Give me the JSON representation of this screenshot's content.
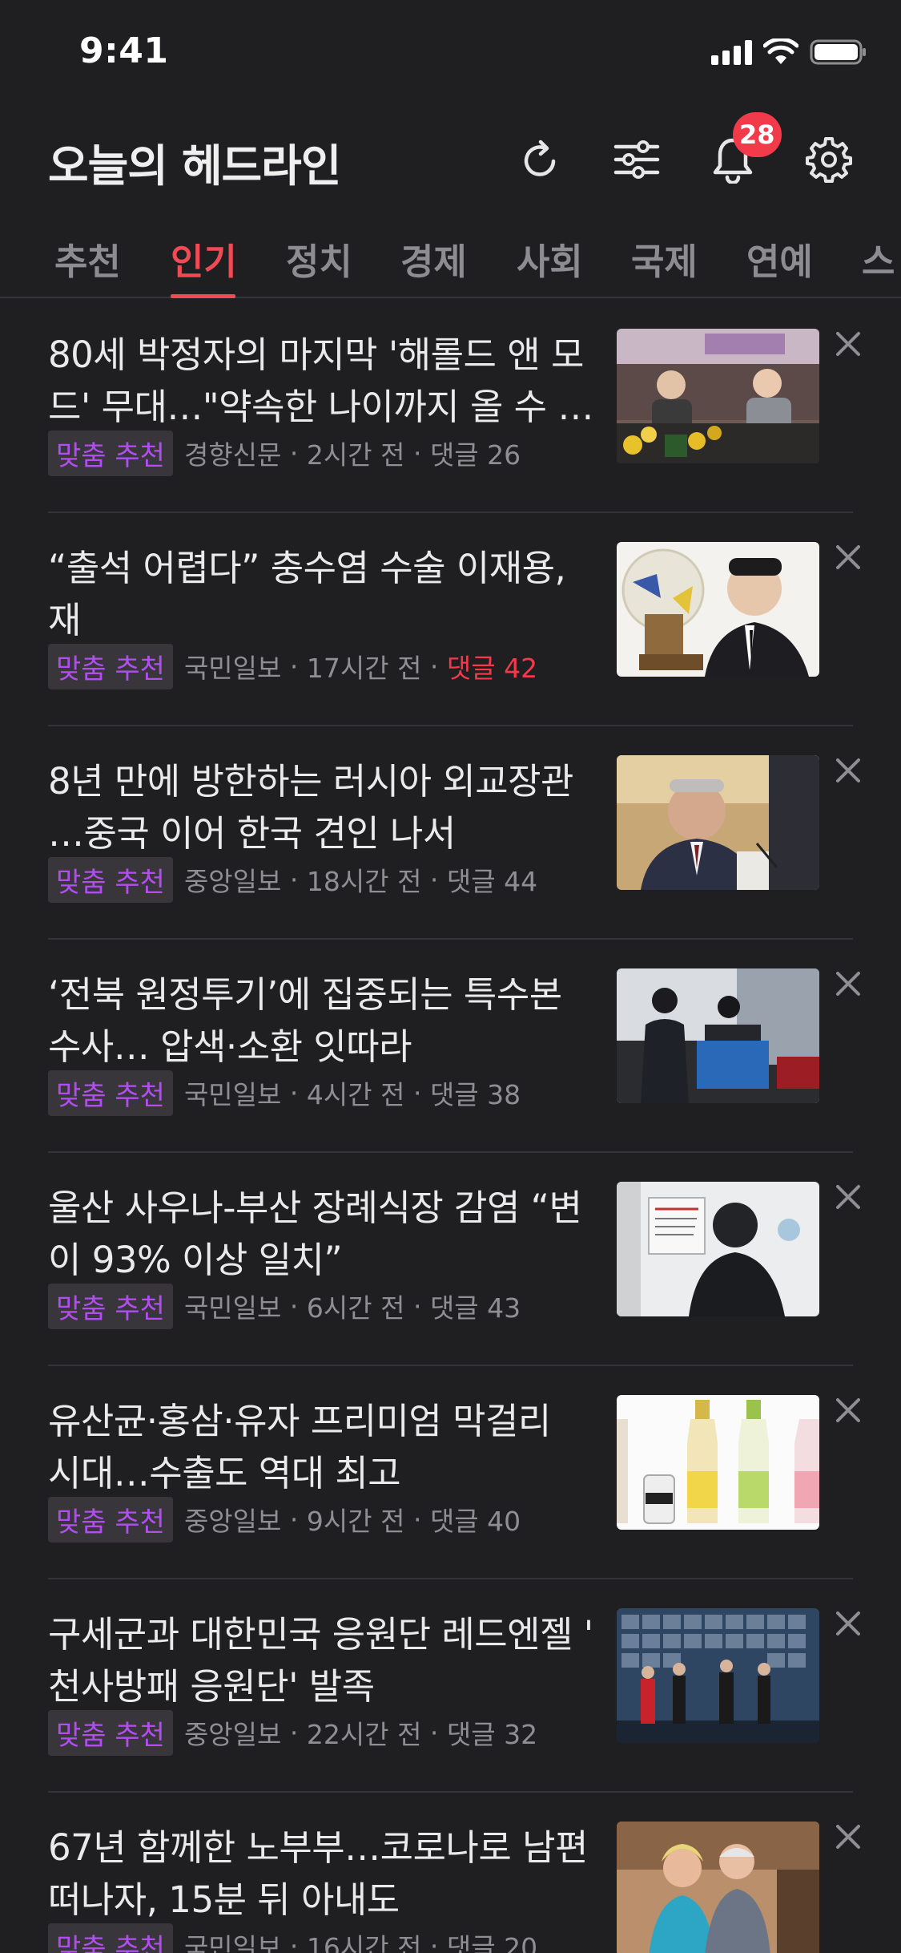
{
  "status_bar": {
    "time": "9:41"
  },
  "header": {
    "title": "오늘의 헤드라인",
    "notification_count": "28"
  },
  "tabs": [
    {
      "label": "추천",
      "active": false
    },
    {
      "label": "인기",
      "active": true
    },
    {
      "label": "정치",
      "active": false
    },
    {
      "label": "경제",
      "active": false
    },
    {
      "label": "사회",
      "active": false
    },
    {
      "label": "국제",
      "active": false
    },
    {
      "label": "연예",
      "active": false
    },
    {
      "label": "스",
      "active": false
    }
  ],
  "recommend_label": "맞춤 추천",
  "articles": [
    {
      "headline": "80세 박정자의 마지막 '해롤드 앤 모\n드' 무대…\"약속한 나이까지 올 수 …",
      "source": "경향신문",
      "time": "2시간 전",
      "comments": "댓글 26",
      "comments_hot": false
    },
    {
      "headline": "“출석 어렵다” 충수염 수술 이재용, 재\n판 연기 신청",
      "source": "국민일보",
      "time": "17시간 전",
      "comments": "댓글 42",
      "comments_hot": true
    },
    {
      "headline": "8년 만에 방한하는 러시아 외교장관\n…중국 이어 한국 견인 나서",
      "source": "중앙일보",
      "time": "18시간 전",
      "comments": "댓글 44",
      "comments_hot": false
    },
    {
      "headline": "‘전북 원정투기’에 집중되는 특수본\n수사… 압색·소환 잇따라",
      "source": "국민일보",
      "time": "4시간 전",
      "comments": "댓글 38",
      "comments_hot": false
    },
    {
      "headline": "울산 사우나-부산 장례식장 감염 “변\n이 93% 이상 일치”",
      "source": "국민일보",
      "time": "6시간 전",
      "comments": "댓글 43",
      "comments_hot": false
    },
    {
      "headline": "유산균·홍삼·유자 프리미엄 막걸리\n시대…수출도 역대 최고",
      "source": "중앙일보",
      "time": "9시간 전",
      "comments": "댓글 40",
      "comments_hot": false
    },
    {
      "headline": "구세군과 대한민국 응원단 레드엔젤 '\n천사방패 응원단' 발족",
      "source": "중앙일보",
      "time": "22시간 전",
      "comments": "댓글 32",
      "comments_hot": false
    },
    {
      "headline": "67년 함께한 노부부…코로나로 남편\n떠나자, 15분 뒤 아내도",
      "source": "국민일보",
      "time": "16시간 전",
      "comments": "댓글 20",
      "comments_hot": false
    }
  ],
  "icons": {
    "refresh": "refresh-icon",
    "filter": "sliders-icon",
    "bell": "bell-icon",
    "settings": "gear-icon",
    "dismiss": "close-icon"
  },
  "colors": {
    "background": "#1f1e21",
    "accent": "#f04a55",
    "badge": "#f13a4a",
    "recommend": "#b24ef0"
  }
}
